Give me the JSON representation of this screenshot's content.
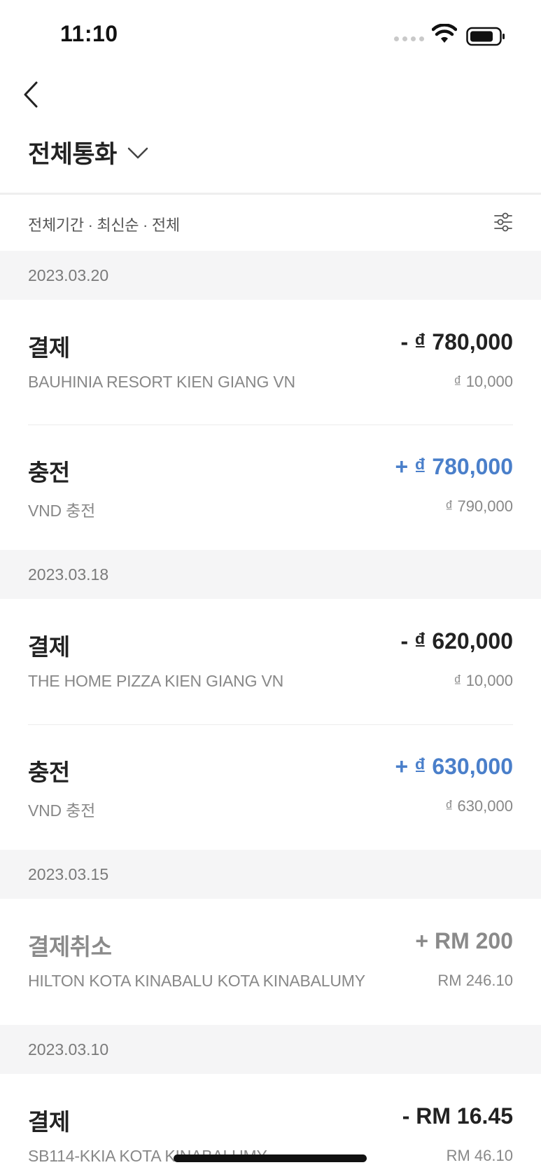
{
  "status_bar": {
    "time": "11:10"
  },
  "header": {
    "title": "전체통화"
  },
  "filter": {
    "summary": "전체기간 · 최신순 · 전체"
  },
  "groups": [
    {
      "date": "2023.03.20",
      "transactions": [
        {
          "type": "결제",
          "merchant": "BAUHINIA RESORT KIEN GIANG VN",
          "amount": "- ₫ 780,000",
          "balance": "₫ 10,000"
        },
        {
          "type": "충전",
          "merchant": "VND 충전",
          "amount": "+ ₫ 780,000",
          "balance": "₫ 790,000"
        }
      ]
    },
    {
      "date": "2023.03.18",
      "transactions": [
        {
          "type": "결제",
          "merchant": "THE HOME PIZZA KIEN GIANG VN",
          "amount": "- ₫ 620,000",
          "balance": "₫ 10,000"
        },
        {
          "type": "충전",
          "merchant": "VND 충전",
          "amount": "+ ₫ 630,000",
          "balance": "₫ 630,000"
        }
      ]
    },
    {
      "date": "2023.03.15",
      "transactions": [
        {
          "type": "결제취소",
          "merchant": "HILTON KOTA KINABALU KOTA KINABALUMY",
          "amount": "+ RM 200",
          "balance": "RM 246.10"
        }
      ]
    },
    {
      "date": "2023.03.10",
      "transactions": [
        {
          "type": "결제",
          "merchant": "SB114-KKIA KOTA KINABALUMY",
          "amount": "- RM 16.45",
          "balance": "RM 46.10"
        }
      ]
    }
  ],
  "colors": {
    "plus_amount": "#4a7fca",
    "date_header_bg": "#f5f5f6",
    "cancelled_text": "#8a8a8a"
  }
}
